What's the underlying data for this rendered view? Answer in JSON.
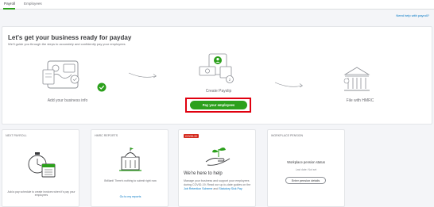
{
  "tabs": [
    {
      "label": "Payroll",
      "active": true
    },
    {
      "label": "Employees",
      "active": false
    }
  ],
  "help_link": "Need help with payroll?",
  "setup": {
    "title": "Let's get your business ready for payday",
    "subtitle": "We'll guide you through the steps to accurately and confidently pay your employees",
    "steps": [
      {
        "label": "Add your business info",
        "icon": "business-info-icon"
      },
      {
        "label": "Create Payslip",
        "icon": "payslip-icon"
      },
      {
        "label": "File with HMRC",
        "icon": "hmrc-building-icon"
      }
    ],
    "pay_button": "Pay your employees"
  },
  "cards": {
    "next_payroll": {
      "title": "NEXT PAYROLL",
      "text": "Add a pay schedule to create invoices when it's pay your employees"
    },
    "hmrc_reports": {
      "title": "HMRC REPORTS",
      "text": "Brilliant! There's nothing to submit right now",
      "link": "Go to my reports"
    },
    "covid": {
      "badge": "COVID-19",
      "title": "We're here to help",
      "text_before": "Manage your business and support your employees during COVID-19. Read our up-to-date guides on the",
      "link1": "Job Retention Scheme",
      "text_mid": "and",
      "link2": "Statutory Sick Pay"
    },
    "workplace_pension": {
      "title": "WORKPLACE PENSION",
      "status": "Workplace pension status",
      "sub": "Last date: Not set",
      "button": "Enter pension details"
    }
  },
  "colors": {
    "brand_green": "#2ca01c",
    "link_blue": "#0077c5",
    "highlight_red": "#e0000f"
  }
}
